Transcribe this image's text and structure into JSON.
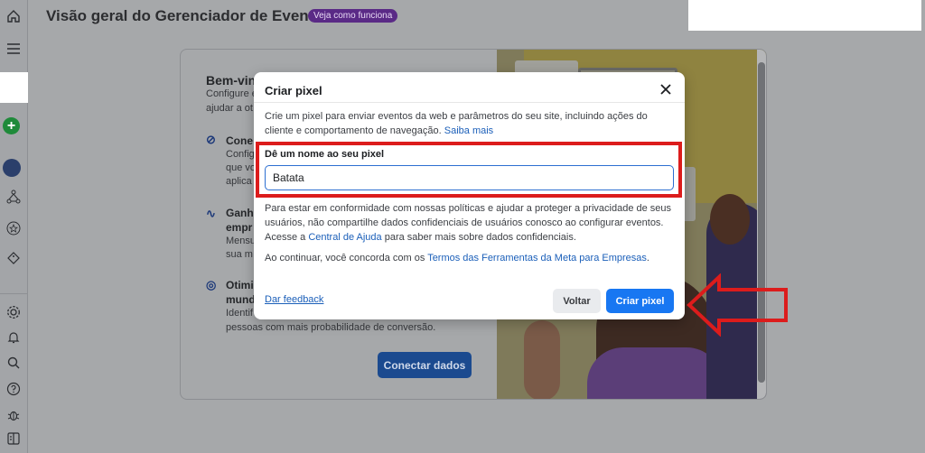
{
  "header": {
    "title": "Visão geral do Gerenciador de Eventos",
    "badge": "Veja como funciona"
  },
  "sidebar": {
    "icons": [
      "home-icon",
      "menu-icon",
      "add-icon",
      "dashboard-icon",
      "network-icon",
      "star-icon",
      "tag-icon",
      "settings-icon",
      "bell-icon",
      "search-icon",
      "help-icon",
      "bug-icon",
      "panel-icon"
    ]
  },
  "background_card": {
    "heading": "Bem-vin",
    "intro_lines": [
      "Configure e",
      "ajudar a ot"
    ],
    "items": [
      {
        "title": "Cone",
        "lines": [
          "Config",
          "que vo",
          "aplica"
        ]
      },
      {
        "title_lines": [
          "Ganhe",
          "empr"
        ],
        "lines": [
          "Mensu",
          "sua m"
        ]
      },
      {
        "title_lines": [
          "Otimi",
          "mund"
        ],
        "lines": [
          "Identif",
          "pessoas com mais probabilidade de conversão."
        ]
      }
    ],
    "connect_button": "Conectar dados"
  },
  "modal": {
    "title": "Criar pixel",
    "description": "Crie um pixel para enviar eventos da web e parâmetros do seu site, incluindo ações do cliente e comportamento de navegação.",
    "learn_more": "Saiba mais",
    "field_label": "Dê um nome ao seu pixel",
    "field_value": "Batata",
    "privacy_text": "Para estar em conformidade com nossas políticas e ajudar a proteger a privacidade de seus usuários, não compartilhe dados confidenciais de usuários conosco ao configurar eventos. Acesse a",
    "help_center": "Central de Ajuda",
    "privacy_text_end": "para saber mais sobre dados confidenciais.",
    "terms_prefix": "Ao continuar, você concorda com os",
    "terms_link": "Termos das Ferramentas da Meta para Empresas",
    "terms_suffix": ".",
    "feedback": "Dar feedback",
    "back_button": "Voltar",
    "create_button": "Criar pixel"
  },
  "colors": {
    "primary": "#1877f2",
    "annotation": "#dc1c1c",
    "badge": "#5a2a86"
  }
}
